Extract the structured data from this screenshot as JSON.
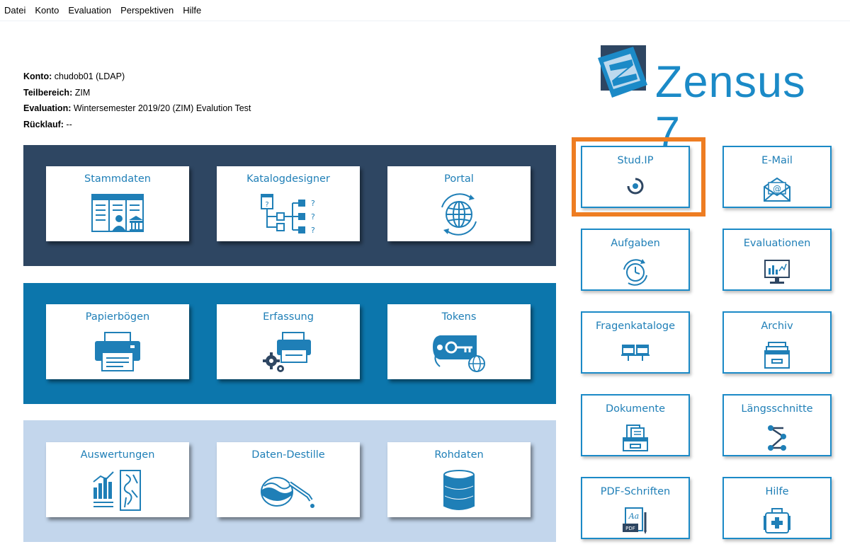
{
  "menu": [
    "Datei",
    "Konto",
    "Evaluation",
    "Perspektiven",
    "Hilfe"
  ],
  "info": {
    "konto_label": "Konto:",
    "konto_value": " chudob01 (LDAP)",
    "teilbereich_label": "Teilbereich:",
    "teilbereich_value": " ZIM",
    "evaluation_label": "Evaluation:",
    "evaluation_value": " Wintersemester 2019/20 (ZIM) Evalution Test",
    "ruecklauf_label": "Rücklauf:",
    "ruecklauf_value": " --"
  },
  "logo": {
    "text": "Zensus 7"
  },
  "panels": {
    "p1": [
      "Stammdaten",
      "Katalogdesigner",
      "Portal"
    ],
    "p2": [
      "Papierbögen",
      "Erfassung",
      "Tokens"
    ],
    "p3": [
      "Auswertungen",
      "Daten-Destille",
      "Rohdaten"
    ]
  },
  "side": [
    "Stud.IP",
    "E-Mail",
    "Aufgaben",
    "Evaluationen",
    "Fragenkataloge",
    "Archiv",
    "Dokumente",
    "Längsschnitte",
    "PDF-Schriften",
    "Hilfe"
  ],
  "icon_texts": {
    "pdf": "PDF",
    "aa": "Aa",
    "q": "?",
    "at": "@"
  },
  "colors": {
    "accent": "#1b8ac7",
    "panel1": "#2e4662",
    "panel2": "#0c76ac",
    "panel3": "#c3d6ec",
    "highlight": "#ee7d22"
  }
}
